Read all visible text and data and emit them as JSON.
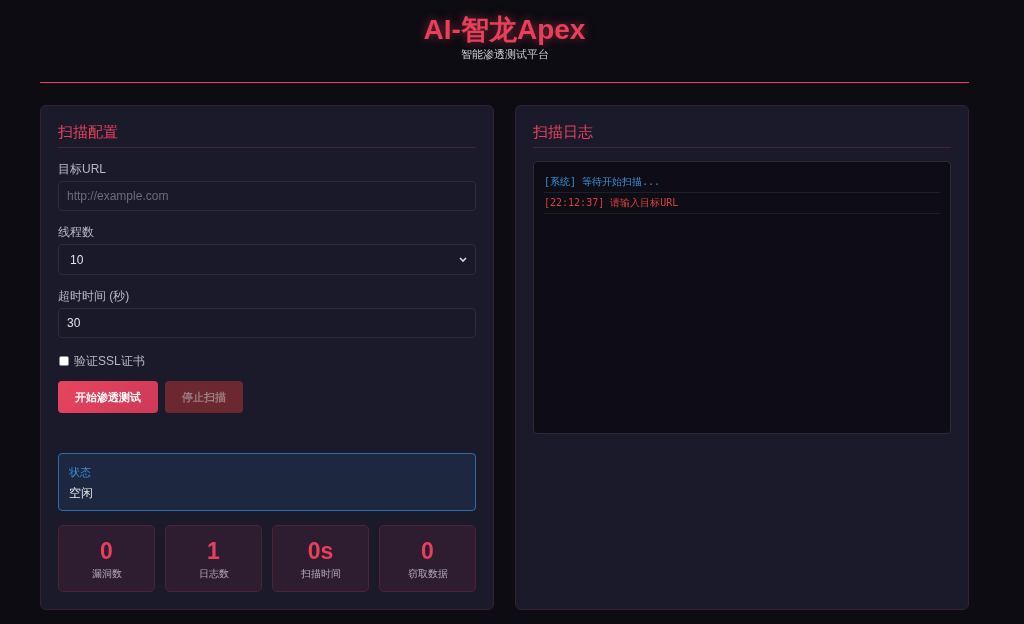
{
  "header": {
    "title": "AI-智龙Apex",
    "subtitle": "智能渗透测试平台"
  },
  "config_panel": {
    "title": "扫描配置",
    "fields": [
      {
        "kind": "text",
        "label": "目标URL",
        "placeholder": "http://example.com"
      },
      {
        "kind": "select",
        "label": "线程数",
        "value": "10"
      },
      {
        "kind": "number",
        "label": "超时时间 (秒)",
        "value": "30"
      }
    ],
    "ssl_checkbox": {
      "label": "验证SSL证书",
      "checked": false
    },
    "buttons": [
      {
        "kind": "start",
        "label": "开始渗透测试",
        "disabled": false
      },
      {
        "kind": "stop",
        "label": "停止扫描",
        "disabled": true
      }
    ],
    "status": {
      "label": "状态",
      "value": "空闲"
    },
    "stats": [
      {
        "value": "0",
        "label": "漏洞数"
      },
      {
        "value": "1",
        "label": "日志数"
      },
      {
        "value": "0s",
        "label": "扫描时间"
      },
      {
        "value": "0",
        "label": "窃取数据"
      }
    ]
  },
  "log_panel": {
    "title": "扫描日志",
    "entries": [
      {
        "kind": "system",
        "text": "[系统] 等待开始扫描..."
      },
      {
        "kind": "error",
        "text": "[22:12:37] 请输入目标URL"
      }
    ]
  }
}
